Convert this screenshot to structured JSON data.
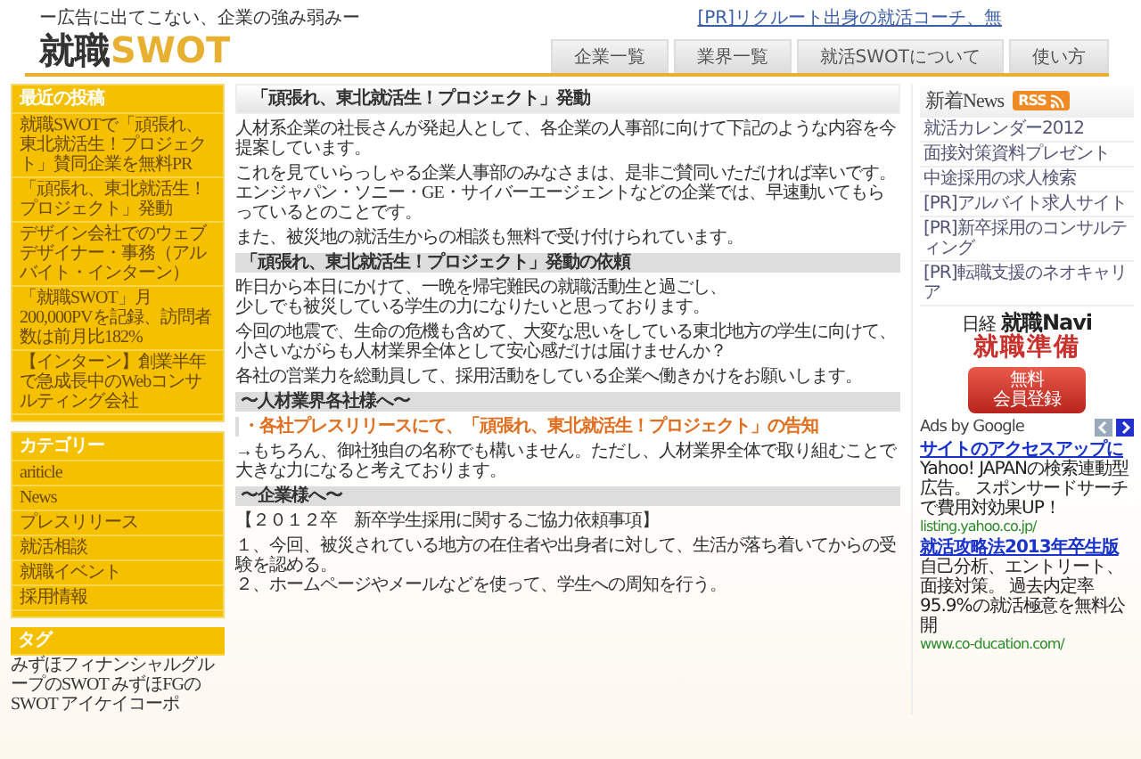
{
  "header": {
    "tagline": "ー広告に出てこない、企業の強み弱みー",
    "logo": {
      "main": "就職",
      "accent": "SWOT"
    },
    "pr_link": "[PR]リクルート出身の就活コーチ、無"
  },
  "nav": [
    {
      "label": "企業一覧"
    },
    {
      "label": "業界一覧"
    },
    {
      "label": "就活SWOTについて"
    },
    {
      "label": "使い方"
    }
  ],
  "sidebar": {
    "recent": {
      "title": "最近の投稿",
      "items": [
        "就職SWOTで「頑張れ、東北就活生！プロジェクト」賛同企業を無料PR",
        "「頑張れ、東北就活生！プロジェクト」発動",
        "デザイン会社でのウェブデザイナー・事務（アルバイト・インターン）",
        "「就職SWOT」月200,000PVを記録、訪問者数は前月比182%",
        "【インターン】創業半年で急成長中のWebコンサルティング会社"
      ]
    },
    "categories": {
      "title": "カテゴリー",
      "items": [
        "ariticle",
        "News",
        "プレスリリース",
        "就活相談",
        "就職イベント",
        "採用情報"
      ]
    },
    "tags": {
      "title": "タグ",
      "text": "みずほフィナンシャルグループのSWOT みずほFGのSWOT アイケイコーポ"
    }
  },
  "article": {
    "title": "「頑張れ、東北就活生！プロジェクト」発動",
    "blocks": [
      {
        "kind": "para",
        "lines": [
          "人材系企業の社長さんが発起人として、各企業の人事部に向けて下記のような内容を今提案しています。"
        ]
      },
      {
        "kind": "para",
        "lines": [
          "これを見ていらっしゃる企業人事部のみなさまは、是非ご賛同いただければ幸いです。",
          "エンジャパン・ソニー・GE・サイバーエージェントなどの企業では、早速動いてもらっているとのことです。"
        ]
      },
      {
        "kind": "para",
        "lines": [
          "また、被災地の就活生からの相談も無料で受け付けられています。"
        ]
      },
      {
        "kind": "heading",
        "lines": [
          "「頑張れ、東北就活生！プロジェクト」発動の依頼"
        ]
      },
      {
        "kind": "para",
        "lines": [
          "昨日から本日にかけて、一晩を帰宅難民の就職活動生と過ごし、",
          "少しでも被災している学生の力になりたいと思っております。"
        ]
      },
      {
        "kind": "para",
        "lines": [
          "今回の地震で、生命の危機も含めて、大変な思いをしている東北地方の学生に向けて、小さいながらも人材業界全体として安心感だけは届けませんか？"
        ]
      },
      {
        "kind": "para",
        "lines": [
          "各社の営業力を総動員して、採用活動をしている企業へ働きかけをお願いします。"
        ]
      },
      {
        "kind": "heading",
        "lines": [
          "〜人材業界各社様へ〜"
        ]
      },
      {
        "kind": "highlight",
        "lines": [
          "・各社プレスリリースにて、「頑張れ、東北就活生！プロジェクト」の告知"
        ]
      },
      {
        "kind": "para",
        "lines": [
          "→もちろん、御社独自の名称でも構いません。ただし、人材業界全体で取り組むことで",
          "大きな力になると考えております。"
        ]
      },
      {
        "kind": "heading",
        "lines": [
          "〜企業様へ〜"
        ]
      },
      {
        "kind": "para",
        "lines": [
          "【２０１２卒　新卒学生採用に関するご協力依頼事項】"
        ]
      },
      {
        "kind": "para",
        "lines": [
          "１、今回、被災されている地方の在住者や出身者に対して、生活が落ち着いてからの受験を認める。",
          "２、ホームページやメールなどを使って、学生への周知を行う。"
        ]
      }
    ]
  },
  "news": {
    "title": "新着News",
    "badge": "RSS",
    "items": [
      "就活カレンダー2012",
      "面接対策資料プレゼント",
      "中途採用の求人検索",
      "[PR]アルバイト求人サイト",
      "[PR]新卒採用のコンサルティング",
      "[PR]転職支援のネオキャリア"
    ]
  },
  "promo": {
    "brand_small": "日経",
    "brand": "就職Navi",
    "headline": "就職準備",
    "button": [
      "無料",
      "会員登録"
    ]
  },
  "ads": {
    "label": "Ads by Google",
    "items": [
      {
        "title": "サイトのアクセスアップに",
        "text": "Yahoo! JAPANの検索連動型広告。 スポンサードサーチで費用対効果UP！",
        "url": "listing.yahoo.co.jp/"
      },
      {
        "title": "就活攻略法2013年卒生版",
        "text": "自己分析、エントリート、面接対策。 過去内定率95.9%の就活極意を無料公開",
        "url": "www.co-ducation.com/"
      }
    ]
  }
}
